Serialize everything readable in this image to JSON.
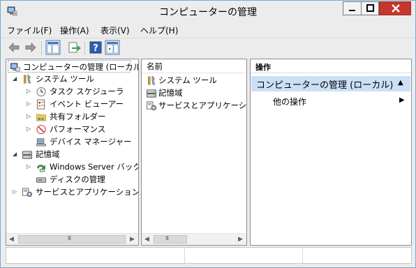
{
  "window": {
    "title": "コンピューターの管理"
  },
  "menu": {
    "items": [
      "ファイル(F)",
      "操作(A)",
      "表示(V)",
      "ヘルプ(H)"
    ]
  },
  "toolbar": {
    "buttons": [
      "back-icon",
      "forward-icon",
      "show-hide-console-tree-icon",
      "export-list-icon",
      "help-icon",
      "show-hide-action-pane-icon"
    ]
  },
  "tree": {
    "root": "コンピューターの管理 (ローカル)",
    "items": [
      {
        "label": "システム ツール",
        "icon": "system-tools-icon"
      },
      {
        "label": "タスク スケジューラ",
        "icon": "task-scheduler-icon"
      },
      {
        "label": "イベント ビューアー",
        "icon": "event-viewer-icon"
      },
      {
        "label": "共有フォルダー",
        "icon": "shared-folders-icon"
      },
      {
        "label": "パフォーマンス",
        "icon": "performance-icon"
      },
      {
        "label": "デバイス マネージャー",
        "icon": "device-manager-icon"
      },
      {
        "label": "記憶域",
        "icon": "storage-icon"
      },
      {
        "label": "Windows Server バック",
        "icon": "windows-server-backup-icon"
      },
      {
        "label": "ディスクの管理",
        "icon": "disk-management-icon"
      },
      {
        "label": "サービスとアプリケーション",
        "icon": "services-apps-icon"
      }
    ]
  },
  "list": {
    "header": "名前",
    "items": [
      "システム ツール",
      "記憶域",
      "サービスとアプリケーション"
    ]
  },
  "actions": {
    "header": "操作",
    "section": "コンピューターの管理 (ローカル)",
    "item": "他の操作"
  },
  "colors": {
    "selection_band": "#cbdff6",
    "close_button": "#c7362c",
    "window_border": "#79a8d4"
  }
}
